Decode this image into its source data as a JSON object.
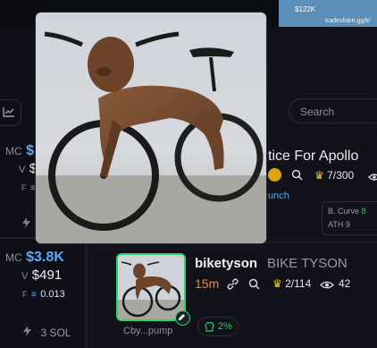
{
  "tweet": {
    "amount": "$122K",
    "source": "tradeshare.gg/k/"
  },
  "search": {
    "placeholder": "Search"
  },
  "left_rows": [
    {
      "mc_label": "MC",
      "mc_value": "$",
      "v_label": "V",
      "v_value": "$",
      "f_label": "F",
      "f_value": ""
    },
    {
      "mc_label": "MC",
      "mc_value": "$3.8K",
      "v_label": "V",
      "v_value": "$491",
      "f_label": "F",
      "f_value": "0.013",
      "sol": "3 SOL"
    }
  ],
  "top_token": {
    "title": "tice For Apollo",
    "holders": "7/300",
    "link": "unch",
    "curve_label": "B. Curve",
    "curve_value": "8",
    "ath_label": "ATH",
    "ath_value": "9"
  },
  "token": {
    "ticker": "biketyson",
    "name": "BIKE TYSON",
    "age": "15m",
    "holders": "2/114",
    "views": "42",
    "address": "Cby...pump",
    "pct": "2%"
  },
  "colors": {
    "accent_blue": "#5aa7ff",
    "positive_green": "#35c46a",
    "age_orange": "#ef8a22",
    "crown_gold": "#f2c233"
  },
  "icons": [
    "chart-icon",
    "coin-icon",
    "search-icon",
    "crown-icon",
    "eye-icon",
    "link-icon",
    "chef-icon",
    "edit-icon",
    "lightning-icon",
    "equals-icon"
  ]
}
